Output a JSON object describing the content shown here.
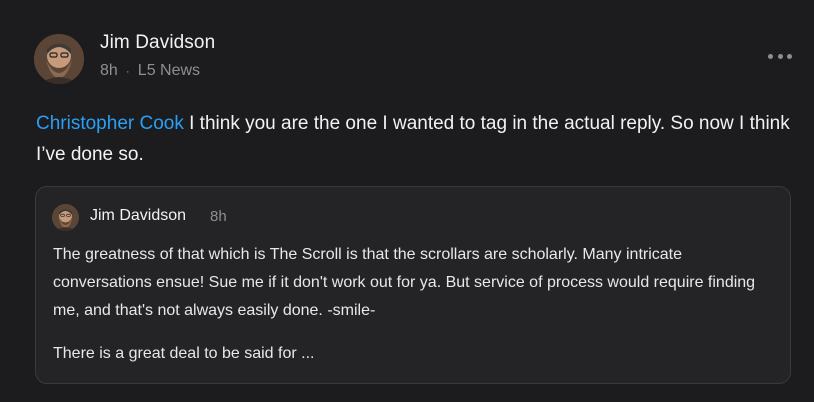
{
  "post": {
    "author": "Jim Davidson",
    "time": "8h",
    "separator": "·",
    "source": "L5 News",
    "mention": "Christopher Cook",
    "text": " I think you are the one I wanted to tag in the actual reply. So now I think I’ve done so.",
    "more_icon": "more-horizontal-icon"
  },
  "quote": {
    "author": "Jim Davidson",
    "time": "8h",
    "paragraph1": "The greatness of that which is The Scroll is that the scrollars are scholarly. Many intricate conversations ensue! Sue me if it don't work out for ya. But service of process would require finding me, and that's not always easily done. -smile-",
    "paragraph2": "There is a great deal to be said for ..."
  },
  "colors": {
    "background": "#1c1c1e",
    "mention": "#2a9ff5",
    "secondary_text": "#8e8e93",
    "quote_border": "#3a3a3c"
  }
}
